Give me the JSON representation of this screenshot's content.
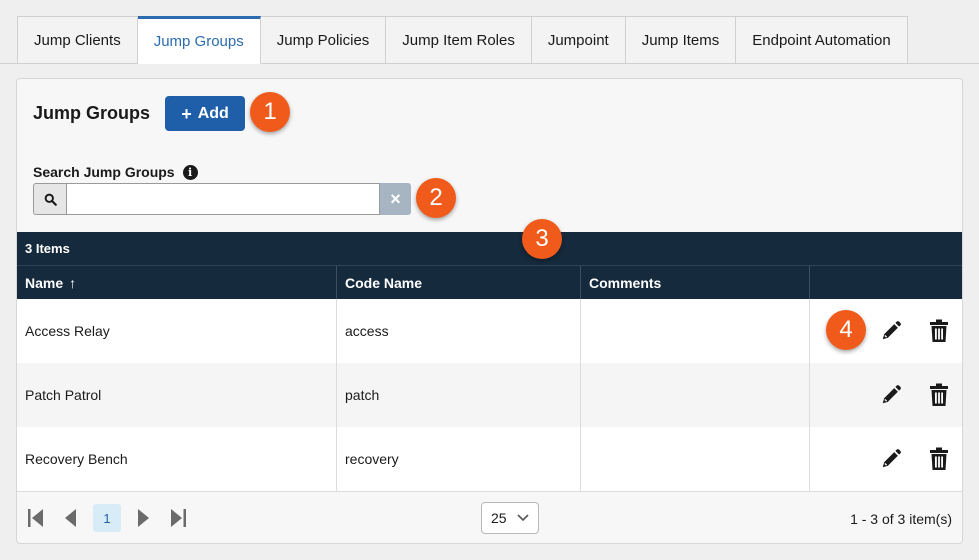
{
  "tabs": [
    {
      "label": "Jump Clients"
    },
    {
      "label": "Jump Groups"
    },
    {
      "label": "Jump Policies"
    },
    {
      "label": "Jump Item Roles"
    },
    {
      "label": "Jumpoint"
    },
    {
      "label": "Jump Items"
    },
    {
      "label": "Endpoint Automation"
    }
  ],
  "active_tab": "Jump Groups",
  "panel": {
    "title": "Jump Groups",
    "add_button": {
      "icon": "+",
      "label": "Add"
    },
    "search": {
      "label": "Search Jump Groups",
      "value": "",
      "info_icon": "info-icon",
      "clear_icon": "×"
    }
  },
  "callouts": [
    "1",
    "2",
    "3",
    "4"
  ],
  "table": {
    "count": "3 Items",
    "headers": {
      "name": "Name",
      "sort_icon": "↑",
      "code_name": "Code Name",
      "comments": "Comments"
    },
    "rows": [
      {
        "name": "Access Relay",
        "code_name": "access",
        "comments": ""
      },
      {
        "name": "Patch Patrol",
        "code_name": "patch",
        "comments": ""
      },
      {
        "name": "Recovery Bench",
        "code_name": "recovery",
        "comments": ""
      }
    ]
  },
  "pagination": {
    "current_page": "1",
    "page_size": "25",
    "summary": "1 - 3 of 3 item(s)"
  },
  "colors": {
    "accent": "#1f5fa9",
    "header": "#162a3d",
    "callout": "#f05a1a"
  }
}
